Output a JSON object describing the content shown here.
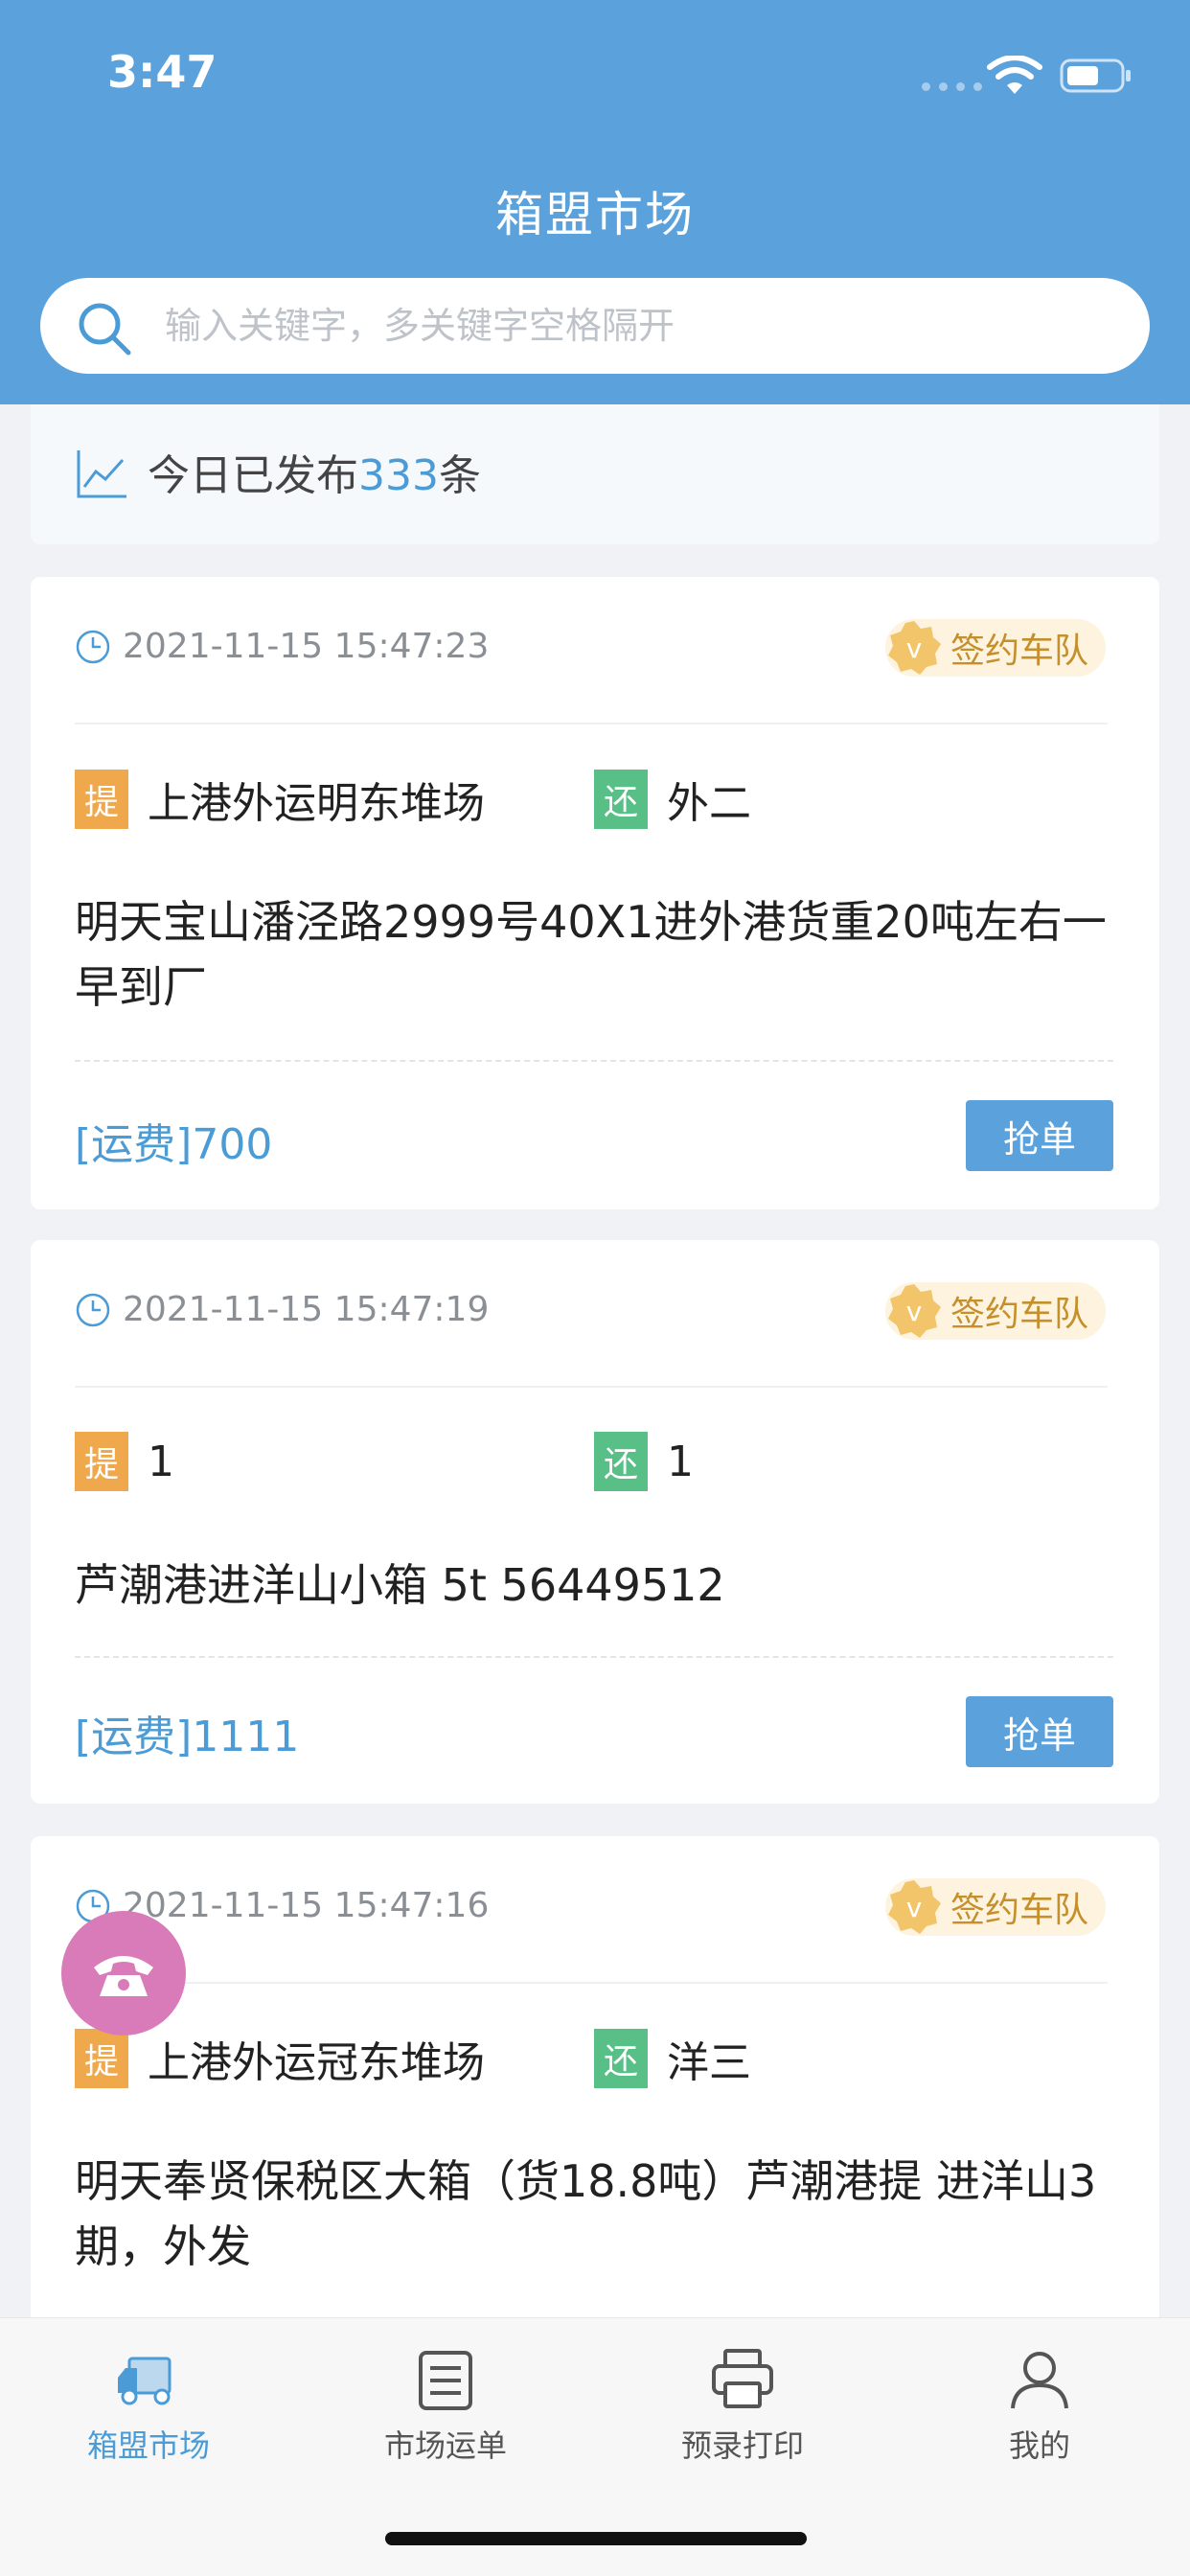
{
  "status_bar": {
    "time": "3:47"
  },
  "header": {
    "title": "箱盟市场",
    "search_placeholder": "输入关键字，多关键字空格隔开"
  },
  "summary": {
    "prefix": "今日已发布",
    "count": "333",
    "suffix": "条"
  },
  "cards": [
    {
      "time": "2021-11-15 15:47:23",
      "badge": "签约车队",
      "pick_tag": "提",
      "pick": "上港外运明东堆场",
      "return_tag": "还",
      "return": "外二",
      "desc": "明天宝山潘泾路2999号40X1进外港货重20吨左右一早到厂",
      "fee": "[运费]700",
      "button": "抢单"
    },
    {
      "time": "2021-11-15 15:47:19",
      "badge": "签约车队",
      "pick_tag": "提",
      "pick": "1",
      "return_tag": "还",
      "return": "1",
      "desc": "芦潮港进洋山小箱 5t 56449512",
      "fee": "[运费]1111",
      "button": "抢单"
    },
    {
      "time": "2021-11-15 15:47:16",
      "badge": "签约车队",
      "pick_tag": "提",
      "pick": "上港外运冠东堆场",
      "return_tag": "还",
      "return": "洋三",
      "desc": "明天奉贤保税区大箱（货18.8吨）芦潮港提 进洋山3期，外发"
    }
  ],
  "tabbar": [
    {
      "label": "箱盟市场",
      "icon": "truck-icon",
      "active": true
    },
    {
      "label": "市场运单",
      "icon": "list-icon",
      "active": false
    },
    {
      "label": "预录打印",
      "icon": "printer-icon",
      "active": false
    },
    {
      "label": "我的",
      "icon": "user-icon",
      "active": false
    }
  ],
  "colors": {
    "header": "#5ba2dc",
    "accent": "#4a9bd6",
    "pick_tag": "#efa94c",
    "return_tag": "#58bf87",
    "badge_text": "#c58f2c",
    "phone_fab": "#d97bb8"
  }
}
